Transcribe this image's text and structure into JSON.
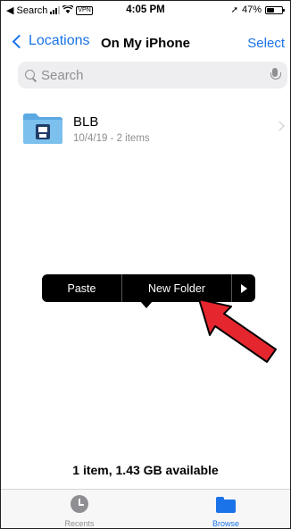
{
  "status_bar": {
    "back_app": "◀ Search",
    "vpn": "VPN",
    "time": "4:05 PM",
    "battery": "47%",
    "battery_level": 0.47,
    "location_glyph": "➚"
  },
  "nav": {
    "back_label": "Locations",
    "title": "On My iPhone",
    "select_label": "Select"
  },
  "search": {
    "placeholder": "Search"
  },
  "folder": {
    "name": "BLB",
    "meta": "10/4/19 - 2 items",
    "icon": "folder-icon"
  },
  "context_menu": {
    "paste": "Paste",
    "new_folder": "New Folder",
    "more_icon": "play-triangle-icon"
  },
  "annotation": {
    "arrow_color": "#e5262e",
    "arrow_outline": "#000000"
  },
  "footer": {
    "storage": "1 item, 1.43 GB available"
  },
  "tabs": [
    {
      "label": "Recents",
      "icon": "clock-icon",
      "active": false
    },
    {
      "label": "Browse",
      "icon": "folder-icon",
      "active": true
    }
  ],
  "colors": {
    "accent": "#1a73e8",
    "folder": "#6fb6e8"
  }
}
